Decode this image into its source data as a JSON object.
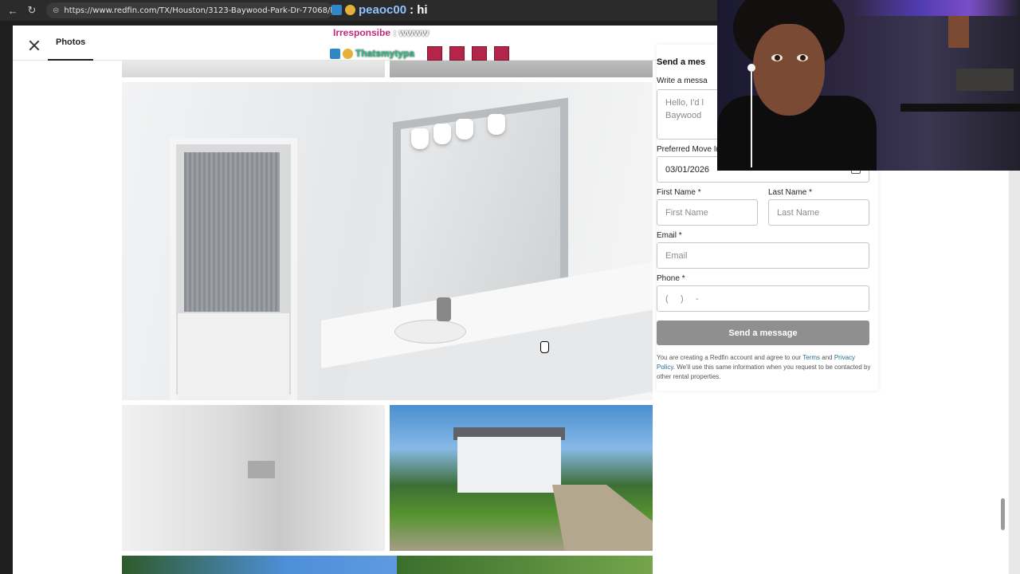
{
  "browser": {
    "url": "https://www.redfin.com/TX/Houston/3123-Baywood-Park-Dr-77068/home/3052196",
    "back_icon": "arrow-left-icon",
    "reload_icon": "reload-icon"
  },
  "chat_top": {
    "user": "peaoc00",
    "message": ": hi"
  },
  "chat_lines": [
    {
      "user": "Irresponsibe",
      "message": ": wwww"
    },
    {
      "user": "Thatsmytypa",
      "message": ":"
    }
  ],
  "photo_view": {
    "tab_label": "Photos",
    "close_icon": "close-icon"
  },
  "form": {
    "title": "Send a mes",
    "message_label": "Write a messa",
    "message_placeholder_line1": "Hello, I'd l",
    "message_placeholder_line2": "Baywood",
    "move_in_label": "Preferred Move In Date",
    "move_in_value": "03/01/2026",
    "first_name_label": "First Name",
    "first_name_placeholder": "First Name",
    "last_name_label": "Last Name",
    "last_name_placeholder": "Last Name",
    "email_label": "Email",
    "email_placeholder": "Email",
    "phone_label": "Phone",
    "phone_placeholder": "(     )     -",
    "required_marker": "*",
    "submit_label": "Send a message",
    "disclaimer_part1": "You are creating a Redfin account and agree to our ",
    "terms_link": "Terms",
    "disclaimer_and": " and ",
    "privacy_link": "Privacy Policy",
    "disclaimer_part2": ". We'll use this same information when you request to be contacted by other rental properties."
  },
  "colors": {
    "submit_button_bg": "#8f8f8f",
    "link": "#1f6f8b",
    "chat_user_pink": "#c3297a",
    "chat_user_green": "#33c28a",
    "chat_user_blue": "#8fc3ff"
  }
}
